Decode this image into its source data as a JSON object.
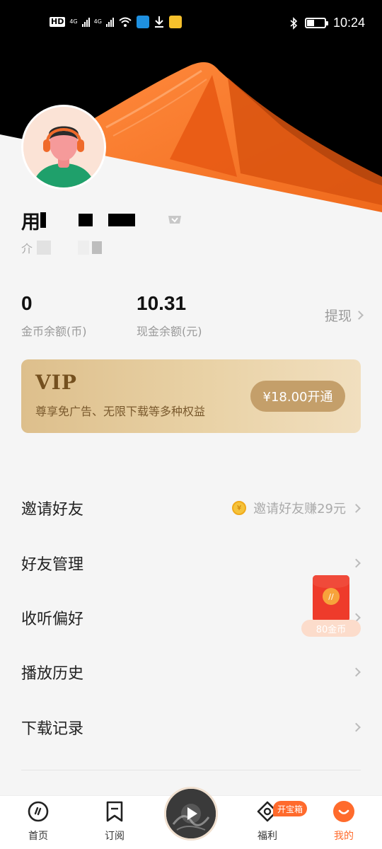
{
  "status_bar": {
    "hd_label": "HD",
    "net1": "4G",
    "net2": "4G",
    "time": "10:24",
    "battery_level": 0.4,
    "icons": [
      "wifi-icon",
      "app-icon",
      "download-icon",
      "folder-app-icon",
      "bluetooth-icon",
      "battery-icon"
    ]
  },
  "profile": {
    "name_prefix": "用",
    "intro_prefix": "介",
    "verified_icon": "badge-icon"
  },
  "balances": {
    "coin_value": "0",
    "coin_label": "金币余额(币)",
    "cash_value": "10.31",
    "cash_label": "现金余额(元)",
    "withdraw_label": "提现"
  },
  "vip": {
    "title": "VIP",
    "subtitle": "尊享免广告、无限下载等多种权益",
    "button_label": "¥18.00开通"
  },
  "menu": {
    "items": [
      {
        "label": "邀请好友",
        "hint": "邀请好友赚29元"
      },
      {
        "label": "好友管理",
        "hint": ""
      },
      {
        "label": "收听偏好",
        "hint": ""
      },
      {
        "label": "播放历史",
        "hint": ""
      },
      {
        "label": "下载记录",
        "hint": ""
      }
    ]
  },
  "red_envelope": {
    "coins_label": "80金币"
  },
  "bottom_nav": {
    "tabs": [
      {
        "label": "首页",
        "icon": "home-icon"
      },
      {
        "label": "订阅",
        "icon": "bookmark-icon"
      },
      {
        "label": "福利",
        "icon": "gift-icon"
      },
      {
        "label": "我的",
        "icon": "profile-icon"
      }
    ],
    "badge_label": "开宝箱",
    "player_icon": "play-icon",
    "active_color": "#ff6b2c"
  },
  "colors": {
    "accent": "#ff6b2c",
    "vip_gold": "#c49f6a",
    "header_black": "#000000"
  }
}
